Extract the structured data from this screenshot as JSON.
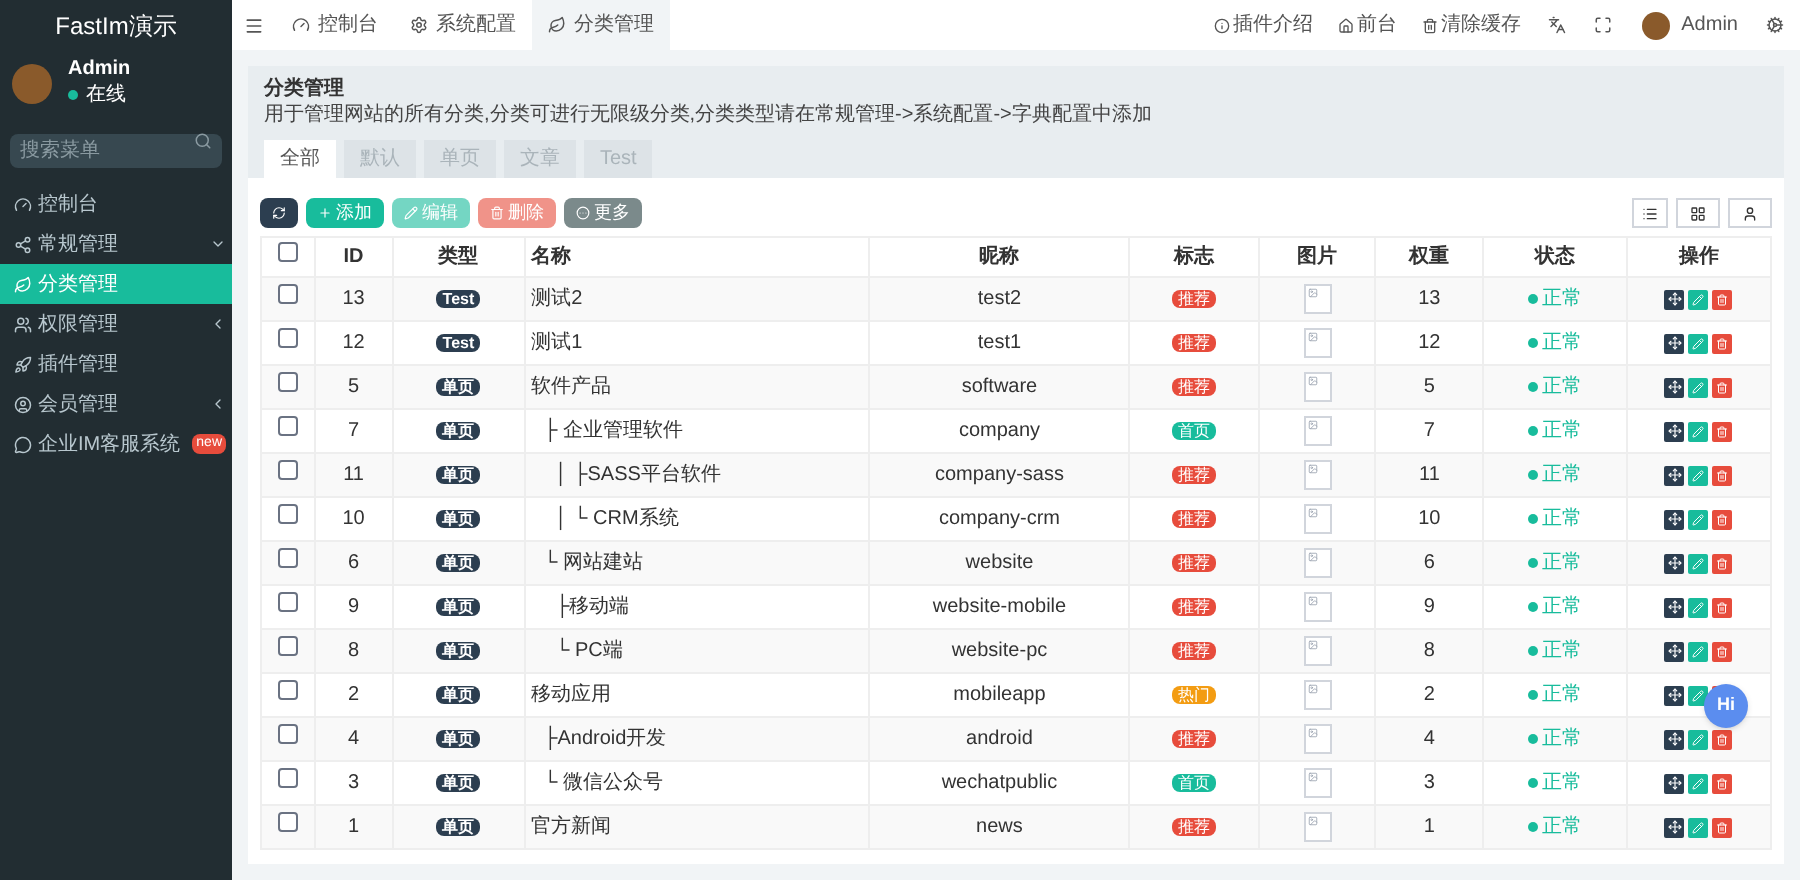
{
  "sidebar": {
    "logo": "FastIm演示",
    "user": {
      "name": "Admin",
      "status": "在线"
    },
    "search": {
      "placeholder": "搜索菜单"
    },
    "items": [
      {
        "kind": "dashboard",
        "label": "控制台",
        "selected": false
      },
      {
        "kind": "cogs",
        "label": "常规管理",
        "selected": false,
        "expanded": true
      },
      {
        "kind": "leaf",
        "label": "分类管理",
        "selected": true
      },
      {
        "kind": "group",
        "label": "权限管理",
        "selected": false,
        "expanded": false
      },
      {
        "kind": "rocket",
        "label": "插件管理",
        "selected": false
      },
      {
        "kind": "user",
        "label": "会员管理",
        "selected": false,
        "expanded": false
      },
      {
        "kind": "comment",
        "label": "企业IM客服系统",
        "selected": false,
        "badge": "new"
      }
    ]
  },
  "topbar": {
    "tabs": [
      {
        "kind": "dashboard",
        "label": "控制台",
        "selected": false
      },
      {
        "kind": "gear",
        "label": "系统配置",
        "selected": false
      },
      {
        "kind": "leaf",
        "label": "分类管理",
        "selected": true
      }
    ],
    "links": [
      {
        "kind": "info",
        "label": "插件介绍"
      },
      {
        "kind": "home",
        "label": "前台"
      },
      {
        "kind": "trash",
        "label": "清除缓存"
      }
    ],
    "user": "Admin"
  },
  "panel": {
    "title": "分类管理",
    "description": "用于管理网站的所有分类,分类可进行无限级分类,分类类型请在常规管理->系统配置->字典配置中添加",
    "tabs": [
      {
        "label": "全部",
        "selected": true
      },
      {
        "label": "默认",
        "selected": false
      },
      {
        "label": "单页",
        "selected": false
      },
      {
        "label": "文章",
        "selected": false
      },
      {
        "label": "Test",
        "selected": false
      }
    ],
    "buttons": [
      {
        "kind": "refresh",
        "disabled": false
      },
      {
        "kind": "add",
        "label": "添加",
        "disabled": false
      },
      {
        "kind": "edit",
        "label": "编辑",
        "disabled": true
      },
      {
        "kind": "delete",
        "label": "删除",
        "disabled": true
      },
      {
        "kind": "more",
        "label": "更多",
        "disabled": false
      }
    ]
  },
  "table": {
    "header_checked": false,
    "columns": [
      "ID",
      "类型",
      "名称",
      "昵称",
      "标志",
      "图片",
      "权重",
      "状态",
      "操作"
    ],
    "rows": [
      {
        "id": "13",
        "type": "Test",
        "name": "测试2",
        "nickname": "test2",
        "flag": {
          "kind": "recommend",
          "label": "推荐"
        },
        "weight": "13",
        "status": "正常",
        "checked": false
      },
      {
        "id": "12",
        "type": "Test",
        "name": "测试1",
        "nickname": "test1",
        "flag": {
          "kind": "recommend",
          "label": "推荐"
        },
        "weight": "12",
        "status": "正常",
        "checked": false
      },
      {
        "id": "5",
        "type": "单页",
        "name": "软件产品",
        "nickname": "software",
        "flag": {
          "kind": "recommend",
          "label": "推荐"
        },
        "weight": "5",
        "status": "正常",
        "checked": false,
        "children": [
          {
            "id": "7",
            "type": "单页",
            "name": "├ 企业管理软件",
            "nickname": "company",
            "flag": {
              "kind": "index",
              "label": "首页"
            },
            "weight": "7",
            "status": "正常",
            "checked": false,
            "children": [
              {
                "id": "11",
                "type": "单页",
                "name": "│ ├SASS平台软件",
                "nickname": "company-sass",
                "flag": {
                  "kind": "recommend",
                  "label": "推荐"
                },
                "weight": "11",
                "status": "正常",
                "checked": false
              },
              {
                "id": "10",
                "type": "单页",
                "name": "│ └ CRM系统",
                "nickname": "company-crm",
                "flag": {
                  "kind": "recommend",
                  "label": "推荐"
                },
                "weight": "10",
                "status": "正常",
                "checked": false
              }
            ]
          },
          {
            "id": "6",
            "type": "单页",
            "name": "└ 网站建站",
            "nickname": "website",
            "flag": {
              "kind": "recommend",
              "label": "推荐"
            },
            "weight": "6",
            "status": "正常",
            "checked": false,
            "children": [
              {
                "id": "9",
                "type": "单页",
                "name": "├移动端",
                "nickname": "website-mobile",
                "flag": {
                  "kind": "recommend",
                  "label": "推荐"
                },
                "weight": "9",
                "status": "正常",
                "checked": false
              },
              {
                "id": "8",
                "type": "单页",
                "name": "└ PC端",
                "nickname": "website-pc",
                "flag": {
                  "kind": "recommend",
                  "label": "推荐"
                },
                "weight": "8",
                "status": "正常",
                "checked": false
              }
            ]
          }
        ]
      },
      {
        "id": "2",
        "type": "单页",
        "name": "移动应用",
        "nickname": "mobileapp",
        "flag": {
          "kind": "hot",
          "label": "热门"
        },
        "weight": "2",
        "status": "正常",
        "checked": false,
        "children": [
          {
            "id": "4",
            "type": "单页",
            "name": "├Android开发",
            "nickname": "android",
            "flag": {
              "kind": "recommend",
              "label": "推荐"
            },
            "weight": "4",
            "status": "正常",
            "checked": false
          },
          {
            "id": "3",
            "type": "单页",
            "name": "└ 微信公众号",
            "nickname": "wechatpublic",
            "flag": {
              "kind": "index",
              "label": "首页"
            },
            "weight": "3",
            "status": "正常",
            "checked": false
          }
        ]
      },
      {
        "id": "1",
        "type": "单页",
        "name": "官方新闻",
        "nickname": "news",
        "flag": {
          "kind": "recommend",
          "label": "推荐"
        },
        "weight": "1",
        "status": "正常",
        "checked": false
      }
    ]
  },
  "chat_bubble": "Hi"
}
